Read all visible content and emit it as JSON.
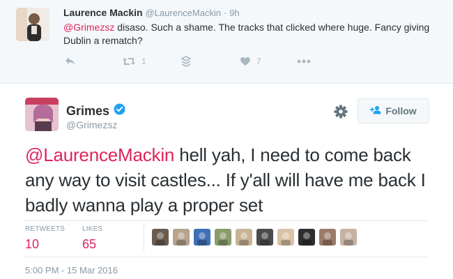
{
  "parent_tweet": {
    "name": "Laurence Mackin",
    "handle": "@LaurenceMackin",
    "separator": "·",
    "time": "9h",
    "mention": "@Grimezsz",
    "text": " disaso. Such a shame.  The tracks that clicked where huge. Fancy giving Dublin a rematch?",
    "retweet_count": "1",
    "like_count": "7"
  },
  "tweet": {
    "name": "Grimes",
    "handle": "@Grimezsz",
    "follow_label": "Follow",
    "mention": "@LaurenceMackin",
    "text": " hell yah, I need to come back any way to visit castles... If y'all will have me back I badly wanna play a proper set",
    "retweets_label": "RETWEETS",
    "retweets_value": "10",
    "likes_label": "LIKES",
    "likes_value": "65",
    "timestamp": "5:00 PM - 15 Mar 2016"
  },
  "colors": {
    "accent_link": "#e0245e",
    "muted": "#8899a6",
    "verified": "#1da1f2",
    "likers": [
      "#6b5a4e",
      "#b7a38e",
      "#3f6fb5",
      "#8a9b6c",
      "#c9b394",
      "#4a4a4a",
      "#d9c3a6",
      "#2e2e2e",
      "#9c7b6a",
      "#c7b2a2"
    ]
  }
}
